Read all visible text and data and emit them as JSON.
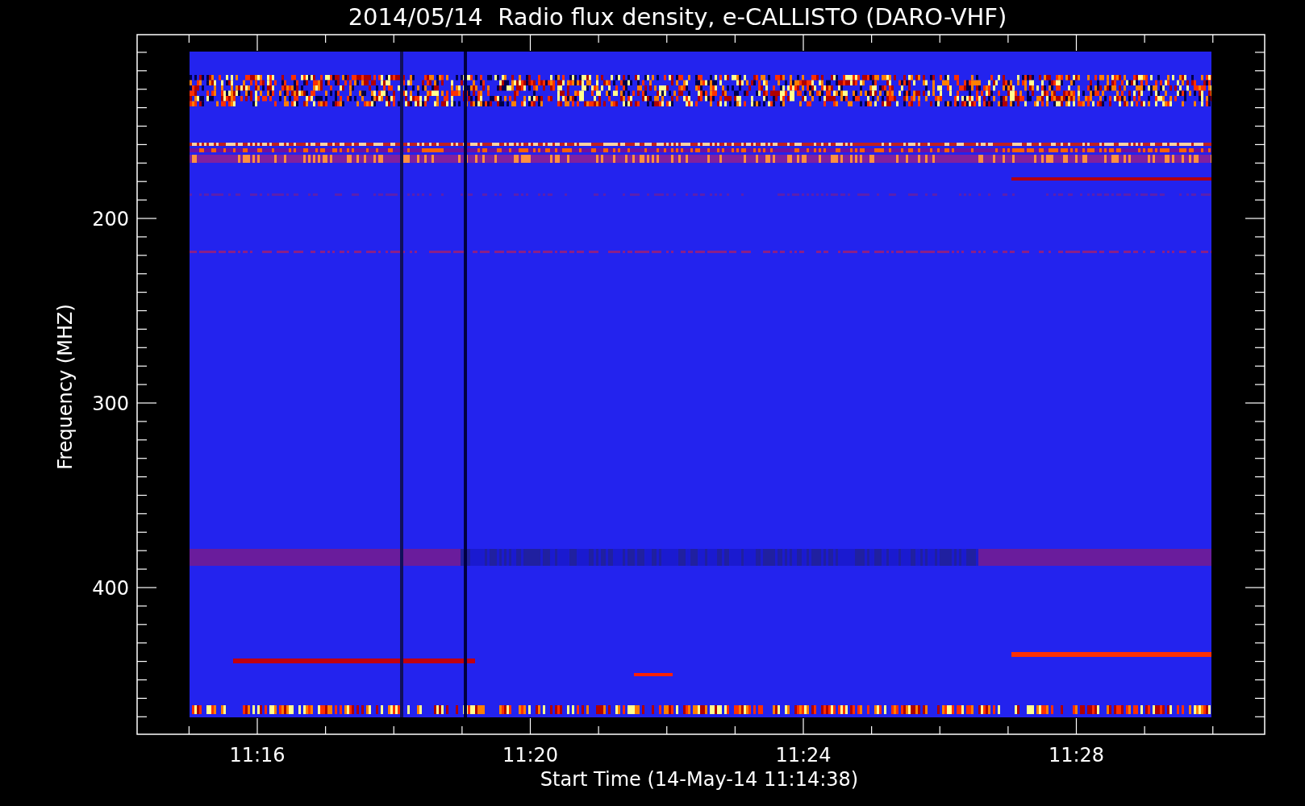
{
  "title": "2014/05/14  Radio flux density, e-CALLISTO (DARO-VHF)",
  "y_axis": {
    "label": "Frequency (MHZ)",
    "ticks": [
      "200",
      "300",
      "400"
    ]
  },
  "x_axis": {
    "label": "Start Time (14-May-14 11:14:38)",
    "ticks": [
      "11:16",
      "11:20",
      "11:24",
      "11:28"
    ]
  }
}
